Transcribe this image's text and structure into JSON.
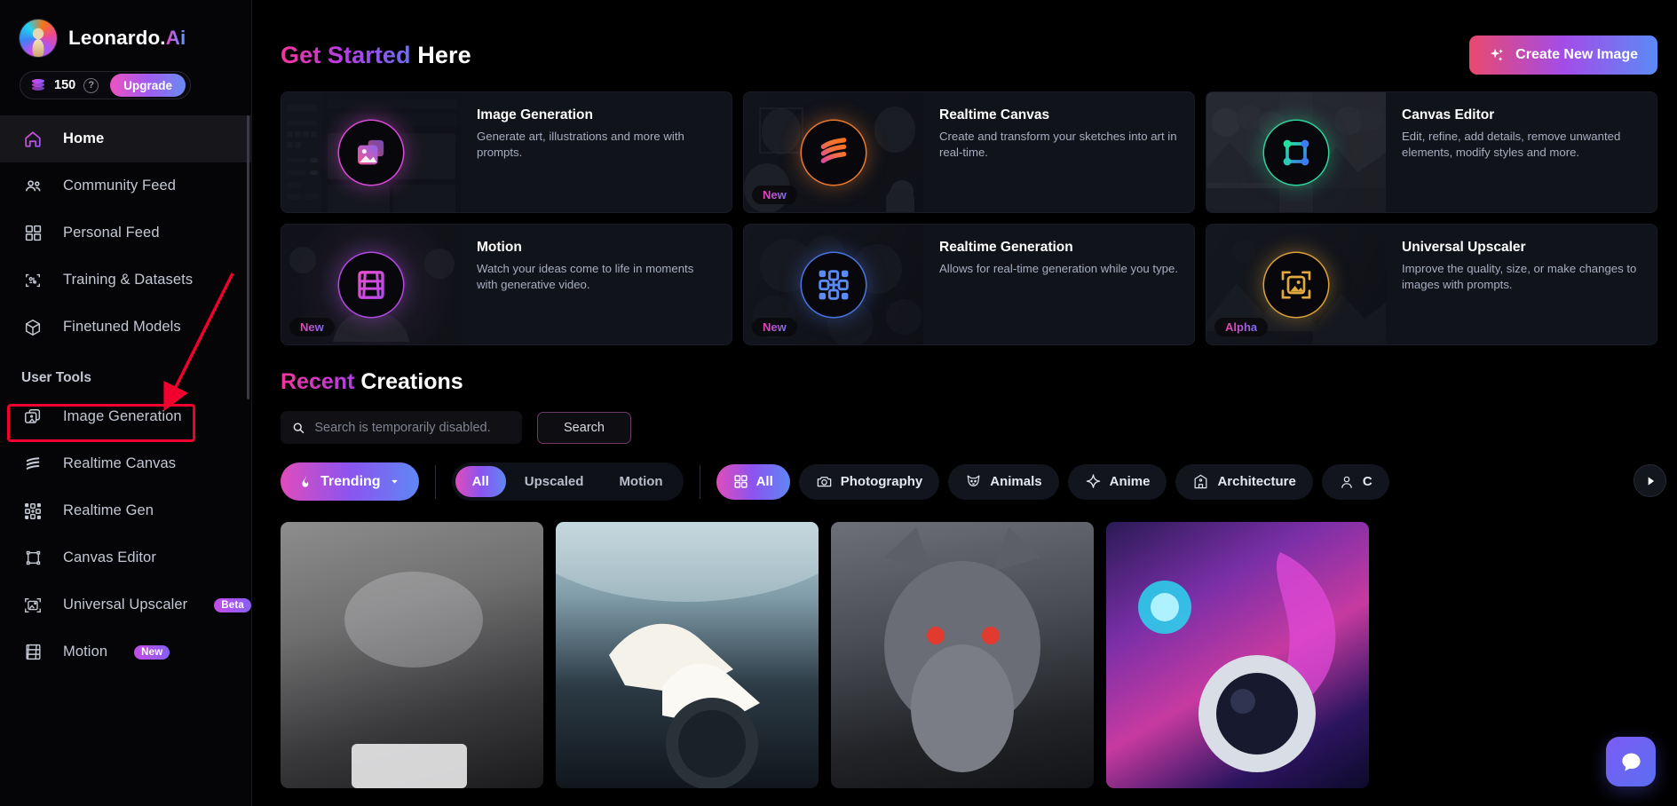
{
  "sidebar": {
    "brand": {
      "name_main": "Leonardo.",
      "name_accent": "Ai"
    },
    "credits": {
      "value": "150",
      "help": "?",
      "upgrade_label": "Upgrade"
    },
    "nav_primary": [
      {
        "label": "Home",
        "icon": "home-icon",
        "active": true
      },
      {
        "label": "Community Feed",
        "icon": "community-icon",
        "active": false
      },
      {
        "label": "Personal Feed",
        "icon": "grid-icon",
        "active": false
      },
      {
        "label": "Training & Datasets",
        "icon": "training-icon",
        "active": false
      },
      {
        "label": "Finetuned Models",
        "icon": "cube-icon",
        "active": false
      }
    ],
    "section_title": "User Tools",
    "nav_tools": [
      {
        "label": "Image Generation",
        "icon": "images-icon",
        "badge": ""
      },
      {
        "label": "Realtime Canvas",
        "icon": "realtime-canvas-icon",
        "badge": ""
      },
      {
        "label": "Realtime Gen",
        "icon": "realtime-gen-icon",
        "badge": ""
      },
      {
        "label": "Canvas Editor",
        "icon": "canvas-editor-icon",
        "badge": ""
      },
      {
        "label": "Universal Upscaler",
        "icon": "upscaler-icon",
        "badge": "Beta"
      },
      {
        "label": "Motion",
        "icon": "motion-icon",
        "badge": "New"
      }
    ]
  },
  "header": {
    "title_grad": "Get Started",
    "title_plain": "Here",
    "create_button": "Create New Image"
  },
  "cards": [
    {
      "title": "Image Generation",
      "desc": "Generate art, illustrations and more with prompts.",
      "badge": "",
      "icon": "image-generation-icon",
      "glow": "pink"
    },
    {
      "title": "Realtime Canvas",
      "desc": "Create and transform your sketches into art in real-time.",
      "badge": "New",
      "icon": "realtime-canvas-icon",
      "glow": "orange"
    },
    {
      "title": "Canvas Editor",
      "desc": "Edit, refine, add details, remove unwanted elements, modify styles and more.",
      "badge": "",
      "icon": "canvas-editor-icon",
      "glow": "green"
    },
    {
      "title": "Motion",
      "desc": "Watch your ideas come to life in moments with generative video.",
      "badge": "New",
      "icon": "motion-icon",
      "glow": "purple"
    },
    {
      "title": "Realtime Generation",
      "desc": "Allows for real-time generation while you type.",
      "badge": "New",
      "icon": "realtime-gen-icon",
      "glow": "blue"
    },
    {
      "title": "Universal Upscaler",
      "desc": "Improve the quality, size, or make changes to images with prompts.",
      "badge": "Alpha",
      "icon": "upscaler-icon",
      "glow": "amber"
    }
  ],
  "recent": {
    "title_grad": "Recent",
    "title_plain": "Creations",
    "search_placeholder": "Search is temporarily disabled.",
    "search_value": "",
    "search_button": "Search",
    "sort_pill": "Trending",
    "type_filters": [
      {
        "label": "All",
        "selected": true
      },
      {
        "label": "Upscaled",
        "selected": false
      },
      {
        "label": "Motion",
        "selected": false
      }
    ],
    "category_filters": [
      {
        "label": "All",
        "icon": "grid-icon",
        "selected": true
      },
      {
        "label": "Photography",
        "icon": "camera-icon",
        "selected": false
      },
      {
        "label": "Animals",
        "icon": "cat-icon",
        "selected": false
      },
      {
        "label": "Anime",
        "icon": "sparkle-icon",
        "selected": false
      },
      {
        "label": "Architecture",
        "icon": "building-icon",
        "selected": false
      },
      {
        "label": "C",
        "icon": "person-icon",
        "selected": false
      }
    ]
  },
  "colors": {
    "accent_pink": "#e04cbb",
    "accent_purple": "#8b54f0",
    "accent_blue": "#5f87f4",
    "annotation_red": "#f1002e",
    "sidebar_bg": "#050507",
    "card_bg": "#11131a"
  }
}
